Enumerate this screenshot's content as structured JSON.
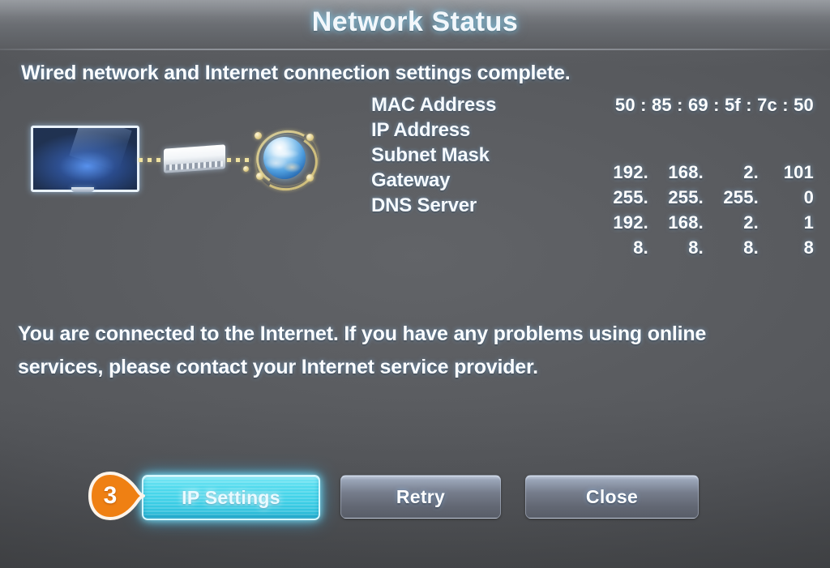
{
  "header": {
    "title": "Network Status"
  },
  "headline": "Wired network and Internet connection settings complete.",
  "diagram": {
    "tv_label": "tv-icon",
    "router_label": "router-icon",
    "globe_label": "globe-icon",
    "cable_label": "ethernet-cable"
  },
  "info": {
    "rows": [
      {
        "label": "MAC Address",
        "value": "50 : 85 : 69 : 5f : 7c : 50",
        "type": "mac"
      },
      {
        "label": "IP Address",
        "octets": [
          "192.",
          "168.",
          "2.",
          "101"
        ],
        "type": "ip"
      },
      {
        "label": "Subnet Mask",
        "octets": [
          "255.",
          "255.",
          "255.",
          "0"
        ],
        "type": "ip"
      },
      {
        "label": "Gateway",
        "octets": [
          "192.",
          "168.",
          "2.",
          "1"
        ],
        "type": "ip"
      },
      {
        "label": "DNS Server",
        "octets": [
          "8.",
          "8.",
          "8.",
          "8"
        ],
        "type": "ip"
      }
    ]
  },
  "status_text": "You are connected to the Internet. If you have any problems using online services, please contact your Internet service provider.",
  "buttons": {
    "ip_settings": "IP Settings",
    "retry": "Retry",
    "close": "Close"
  },
  "step_badge": {
    "number": "3"
  },
  "colors": {
    "background": "#54565a",
    "header": "#73767b",
    "text": "#fbfdff",
    "accent_cyan": "#3fd1e8",
    "badge_orange": "#ef8013",
    "button_gray": "#767d8c",
    "cable_yellow": "#f0e2a0"
  }
}
